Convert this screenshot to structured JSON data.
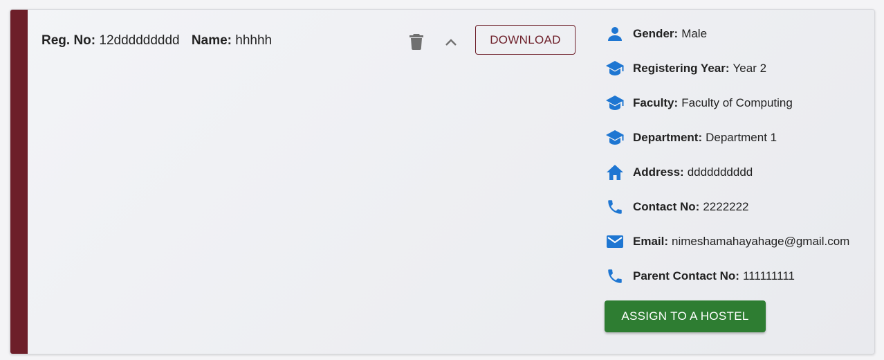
{
  "student": {
    "reg_label": "Reg. No:",
    "reg_value": "12ddddddddd",
    "name_label": "Name:",
    "name_value": "hhhhh"
  },
  "actions": {
    "delete_icon": "trash-icon",
    "collapse_icon": "chevron-up-icon",
    "download_label": "DOWNLOAD",
    "assign_label": "ASSIGN TO A HOSTEL"
  },
  "details": [
    {
      "icon": "person-icon",
      "label": "Gender:",
      "value": "Male"
    },
    {
      "icon": "graduation-cap-icon",
      "label": "Registering Year:",
      "value": "Year 2"
    },
    {
      "icon": "graduation-cap-icon",
      "label": "Faculty:",
      "value": "Faculty of Computing"
    },
    {
      "icon": "graduation-cap-icon",
      "label": "Department:",
      "value": "Department 1"
    },
    {
      "icon": "home-icon",
      "label": "Address:",
      "value": "dddddddddd"
    },
    {
      "icon": "phone-icon",
      "label": "Contact No:",
      "value": "2222222"
    },
    {
      "icon": "email-icon",
      "label": "Email:",
      "value": "nimeshamahayahage@gmail.com"
    },
    {
      "icon": "phone-icon",
      "label": "Parent Contact No:",
      "value": "111111111"
    }
  ],
  "colors": {
    "accent": "#6d1f29",
    "icon": "#1e76d2",
    "assign_button": "#2e7d32",
    "muted_icon": "#707070"
  }
}
